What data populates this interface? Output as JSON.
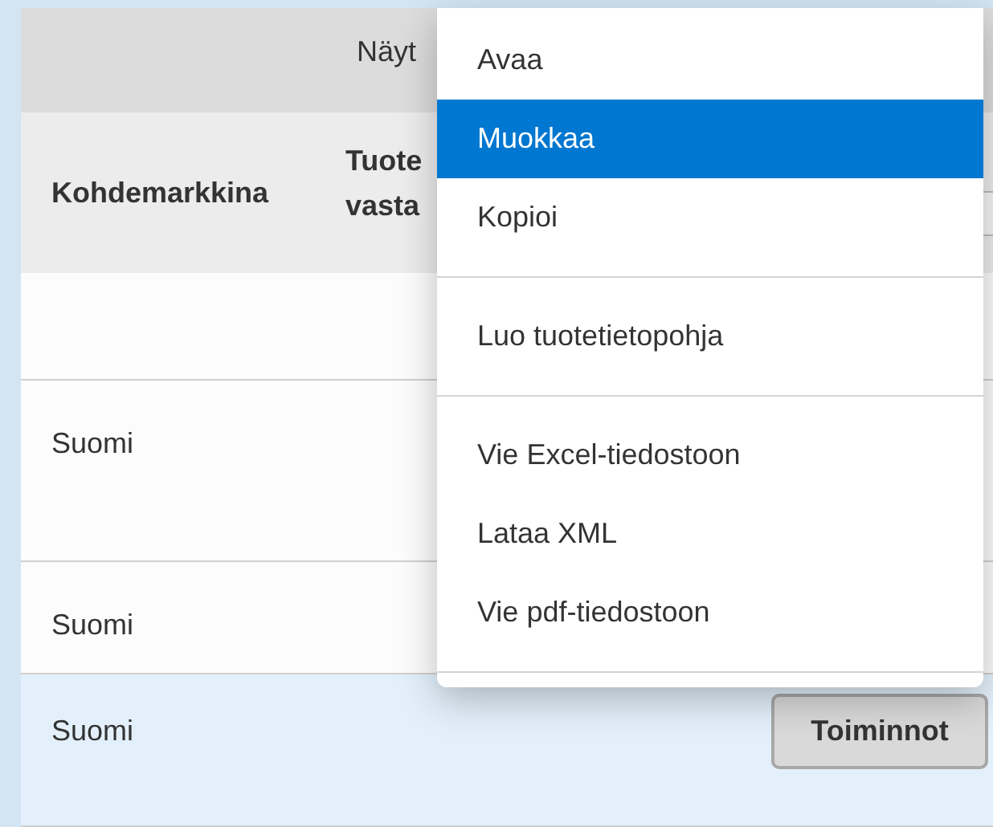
{
  "table": {
    "group_header": "Näyt",
    "columns": [
      {
        "label": "Kohdemarkkina"
      },
      {
        "label": "Tuote vasta"
      }
    ],
    "rows": [
      {
        "market": "",
        "selected": false
      },
      {
        "market": "Suomi",
        "selected": false
      },
      {
        "market": "Suomi",
        "selected": false
      },
      {
        "market": "Suomi",
        "selected": true,
        "action": "Toiminnot"
      }
    ]
  },
  "menu": {
    "groups": [
      [
        {
          "label": "Avaa",
          "selected": false
        },
        {
          "label": "Muokkaa",
          "selected": true
        },
        {
          "label": "Kopioi",
          "selected": false
        }
      ],
      [
        {
          "label": "Luo tuotetietopohja",
          "selected": false
        }
      ],
      [
        {
          "label": "Vie Excel-tiedostoon",
          "selected": false
        },
        {
          "label": "Lataa XML",
          "selected": false
        },
        {
          "label": "Vie pdf-tiedostoon",
          "selected": false
        }
      ]
    ]
  }
}
